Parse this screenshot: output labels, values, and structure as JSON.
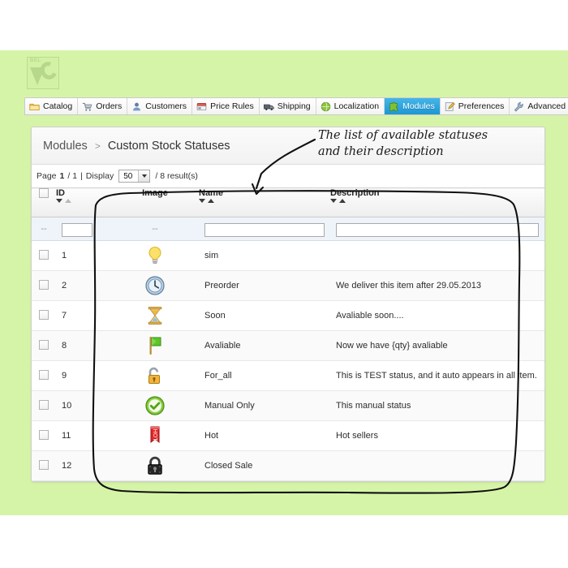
{
  "theme": {
    "page_bg": "#ffffff",
    "band_bg": "#d6f4a8",
    "accent": "#1c96d4",
    "panel_bg": "#ffffff",
    "filter_row_bg": "#eef4f9"
  },
  "logo": {
    "mark_text": "BEL"
  },
  "nav": {
    "tabs": [
      {
        "label": "Catalog",
        "icon": "folder-icon",
        "active": false
      },
      {
        "label": "Orders",
        "icon": "cart-icon",
        "active": false
      },
      {
        "label": "Customers",
        "icon": "user-icon",
        "active": false
      },
      {
        "label": "Price Rules",
        "icon": "pricetag-icon",
        "active": false
      },
      {
        "label": "Shipping",
        "icon": "truck-icon",
        "active": false
      },
      {
        "label": "Localization",
        "icon": "globe-icon",
        "active": false
      },
      {
        "label": "Modules",
        "icon": "puzzle-icon",
        "active": true
      },
      {
        "label": "Preferences",
        "icon": "pencil-pad-icon",
        "active": false
      },
      {
        "label": "Advanced Parameters",
        "icon": "wrench-icon",
        "active": false
      }
    ]
  },
  "breadcrumb": {
    "root": "Modules",
    "separator": ">",
    "current": "Custom Stock Statuses"
  },
  "toolbar": {
    "page_label": "Page",
    "page_current": "1",
    "page_of": "/ 1",
    "divider": "|",
    "display_label": "Display",
    "display_value": "50",
    "results_label": "/ 8 result(s)"
  },
  "table": {
    "columns": [
      {
        "key": "checkbox",
        "label": "",
        "sortable": false
      },
      {
        "key": "id",
        "label": "ID",
        "sortable": true,
        "sort": "asc"
      },
      {
        "key": "image",
        "label": "Image",
        "sortable": false
      },
      {
        "key": "name",
        "label": "Name",
        "sortable": true,
        "sort": "none"
      },
      {
        "key": "description",
        "label": "Description",
        "sortable": true,
        "sort": "none"
      }
    ],
    "filter_row": {
      "checkbox_placeholder": "--",
      "id_value": "",
      "image_placeholder": "--",
      "name_value": "",
      "description_value": ""
    },
    "rows": [
      {
        "id": "1",
        "icon": "lightbulb-icon",
        "name": "sim",
        "description": ""
      },
      {
        "id": "2",
        "icon": "clock-icon",
        "name": "Preorder",
        "description": "We deliver this item after 29.05.2013"
      },
      {
        "id": "7",
        "icon": "hourglass-icon",
        "name": "Soon",
        "description": "Avaliable soon...."
      },
      {
        "id": "8",
        "icon": "green-flag-icon",
        "name": "Avaliable",
        "description": "Now we have {qty} avaliable"
      },
      {
        "id": "9",
        "icon": "unlock-icon",
        "name": "For_all",
        "description": "This is TEST status, and it auto appears in all item."
      },
      {
        "id": "10",
        "icon": "check-circle-icon",
        "name": "Manual Only",
        "description": "This manual status"
      },
      {
        "id": "11",
        "icon": "hot-ribbon-icon",
        "name": "Hot",
        "description": "Hot sellers"
      },
      {
        "id": "12",
        "icon": "lock-icon",
        "name": "Closed Sale",
        "description": ""
      }
    ]
  },
  "annotation": {
    "line1": "The list of available statuses",
    "line2": "and their description"
  }
}
